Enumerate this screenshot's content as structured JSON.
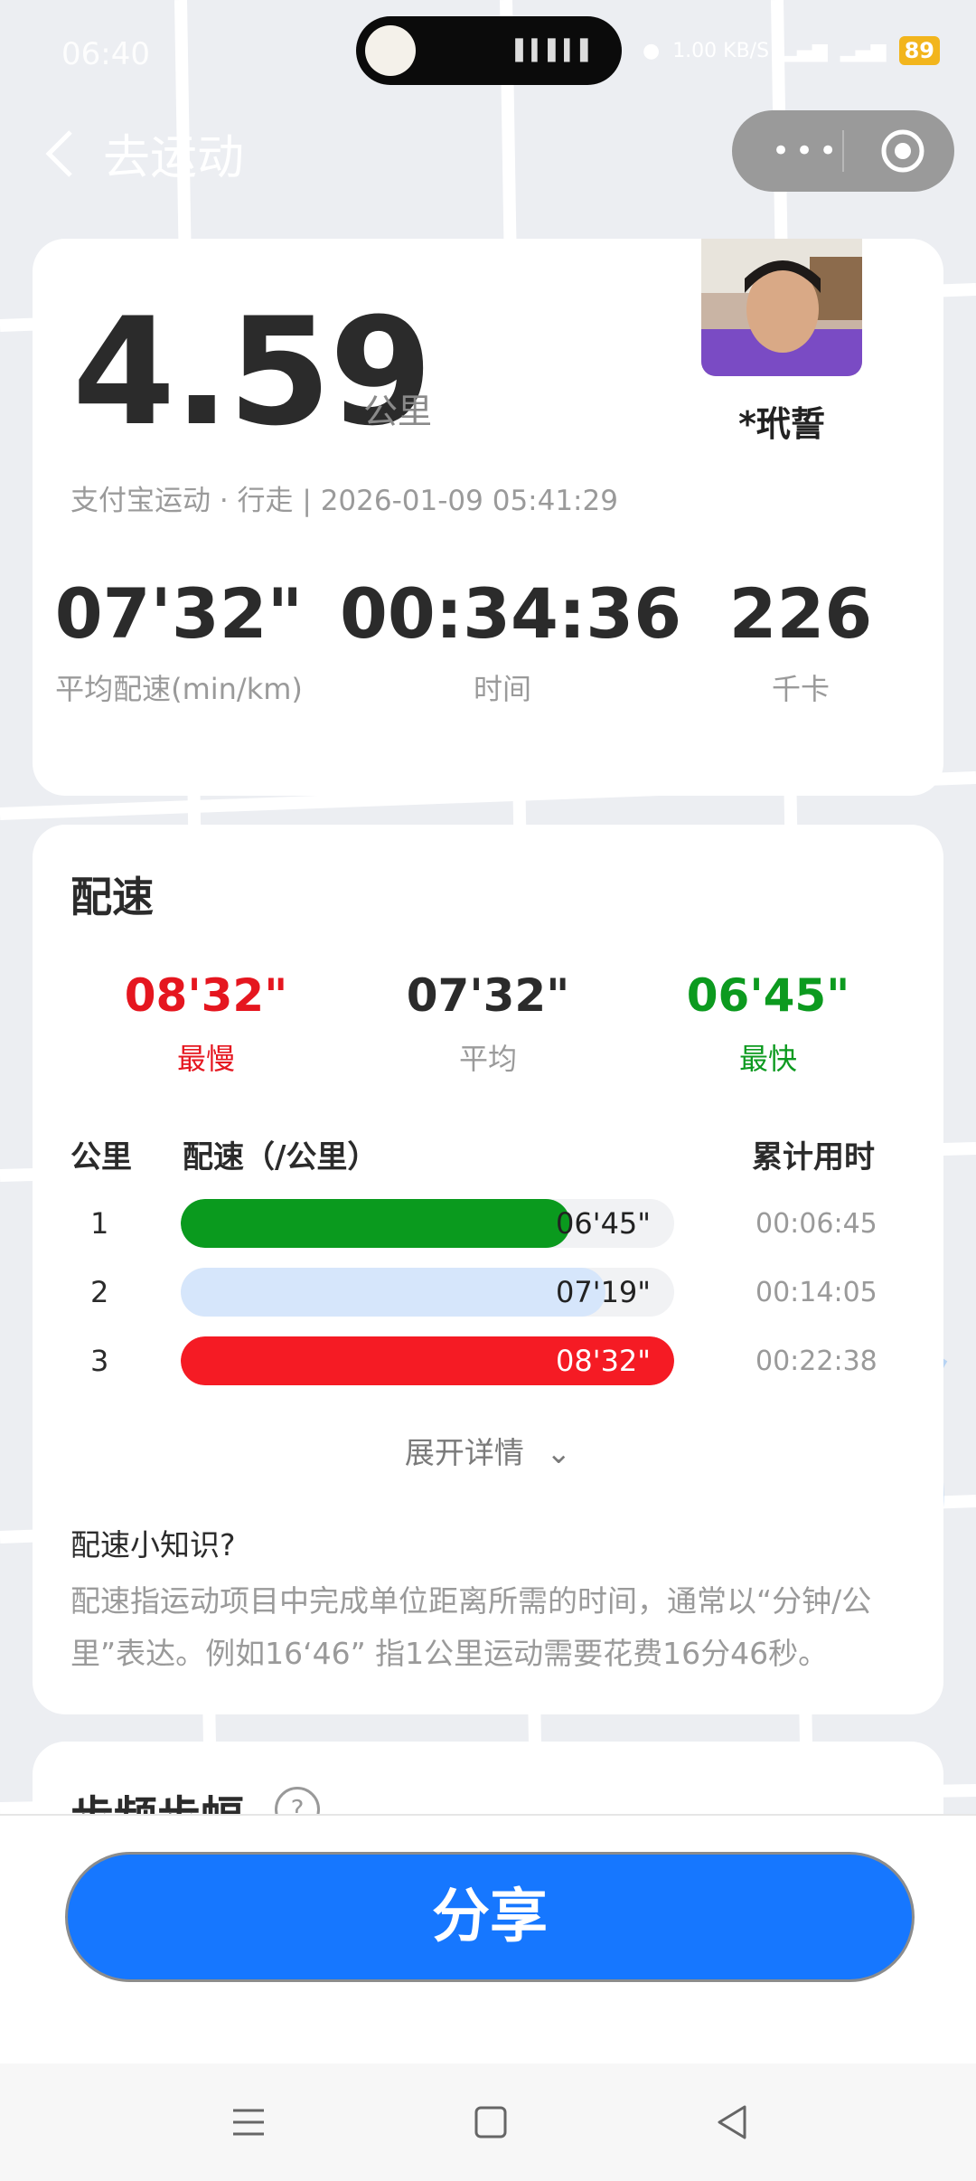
{
  "status_bar": {
    "time": "06:40",
    "speed": "1.00 KB/S",
    "battery": "89"
  },
  "nav": {
    "title": "去运动"
  },
  "summary": {
    "distance": "4.59",
    "distance_unit": "公里",
    "user_name": "*玳誓",
    "meta": "支付宝运动 · 行走 | 2026-01-09 05:41:29",
    "stats": [
      {
        "value": "07'32\"",
        "label": "平均配速(min/km)"
      },
      {
        "value": "00:34:36",
        "label": "时间"
      },
      {
        "value": "226",
        "label": "千卡"
      }
    ]
  },
  "pace": {
    "title": "配速",
    "slowest": {
      "value": "08'32\"",
      "label": "最慢"
    },
    "average": {
      "value": "07'32\"",
      "label": "平均"
    },
    "fastest": {
      "value": "06'45\"",
      "label": "最快"
    },
    "headers": {
      "km": "公里",
      "pace": "配速（/公里）",
      "cumulative": "累计用时"
    },
    "rows": [
      {
        "km": "1",
        "pace": "06'45\"",
        "cumulative": "00:06:45",
        "fill": 0.79,
        "color": "#0a9a1e"
      },
      {
        "km": "2",
        "pace": "07'19\"",
        "cumulative": "00:14:05",
        "fill": 0.86,
        "color": "#d6e6fb"
      },
      {
        "km": "3",
        "pace": "08'32\"",
        "cumulative": "00:22:38",
        "fill": 1.0,
        "color": "#f51b24"
      }
    ],
    "expand": "展开详情",
    "tip_title": "配速小知识?",
    "tip_body": "配速指运动项目中完成单位距离所需的时间，通常以“分钟/公里”表达。例如16‘46” 指1公里运动需要花费16分46秒。",
    "colors": {
      "slow": "#e5161f",
      "avg": "#2b2b2b",
      "fast": "#0c9a1f"
    }
  },
  "cadence": {
    "title": "步频步幅",
    "help": "?"
  },
  "share_button": "分享"
}
